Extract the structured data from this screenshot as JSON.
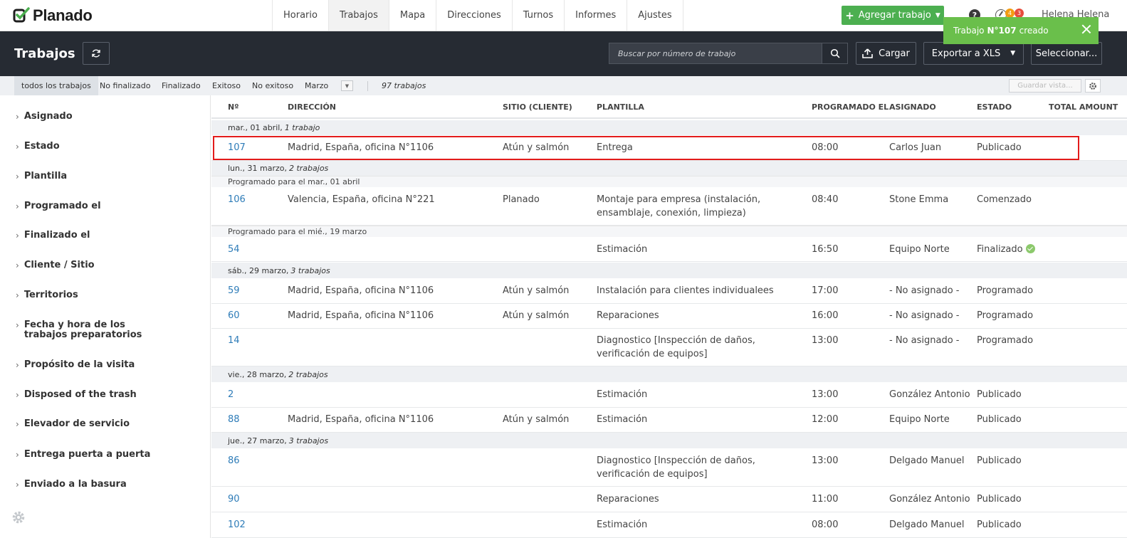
{
  "app": {
    "brand": "Planado"
  },
  "nav": {
    "tabs": [
      {
        "label": "Horario",
        "active": false
      },
      {
        "label": "Trabajos",
        "active": true
      },
      {
        "label": "Mapa",
        "active": false
      },
      {
        "label": "Direcciones",
        "active": false
      },
      {
        "label": "Turnos",
        "active": false
      },
      {
        "label": "Informes",
        "active": false
      },
      {
        "label": "Ajustes",
        "active": false
      }
    ],
    "add_job_label": "Agregar trabajo",
    "help_label": "?",
    "badge_orange": "4",
    "badge_red": "3",
    "user_name": "Helena Helena"
  },
  "toast": {
    "prefix": "Trabajo",
    "number": "N°107",
    "suffix": "creado"
  },
  "header": {
    "title": "Trabajos",
    "search_placeholder": "Buscar por número de trabajo",
    "upload_label": "Cargar",
    "export_label": "Exportar a XLS",
    "select_label": "Seleccionar..."
  },
  "filters": {
    "items": [
      "todos los trabajos",
      "No finalizado",
      "Finalizado",
      "Exitoso",
      "No exitoso",
      "Marzo"
    ],
    "active_index": 0,
    "count": "97 trabajos",
    "save_view": "Guardar vista..."
  },
  "sidebar": {
    "items": [
      "Asignado",
      "Estado",
      "Plantilla",
      "Programado el",
      "Finalizado el",
      "Cliente / Sitio",
      "Territorios",
      "Fecha y hora de los trabajos preparatorios",
      "Propósito de la visita",
      "Disposed of the trash",
      "Elevador de servicio",
      "Entrega puerta a puerta",
      "Enviado a la basura"
    ]
  },
  "table": {
    "columns": [
      "Nº",
      "Dirección",
      "Sitio (cliente)",
      "Plantilla",
      "Programado el",
      "Asignado",
      "Estado",
      "Total amount"
    ],
    "groups": [
      {
        "date": "mar., 01 abril,",
        "count": "1 trabajo"
      },
      {
        "date": "lun., 31 marzo,",
        "count": "2 trabajos"
      },
      {
        "date": "sáb., 29 marzo,",
        "count": "3 trabajos"
      },
      {
        "date": "vie., 28 marzo,",
        "count": "2 trabajos"
      },
      {
        "date": "jue., 27 marzo,",
        "count": "3 trabajos"
      }
    ],
    "subgroups": [
      "Programado para el mar., 01 abril",
      "Programado para el mié., 19 marzo"
    ],
    "rows": [
      {
        "num": "107",
        "address": "Madrid, España, oficina N°1106",
        "site": "Atún y salmón",
        "template": "Entrega",
        "time": "08:00",
        "assignee": "Carlos Juan",
        "status": "Publicado"
      },
      {
        "num": "106",
        "address": "Valencia, España, oficina N°221",
        "site": "Planado",
        "template": "Montaje para empresa (instalación, ensamblaje, conexión, limpieza)",
        "time": "08:40",
        "assignee": "Stone Emma",
        "status": "Comenzado"
      },
      {
        "num": "54",
        "address": "",
        "site": "",
        "template": "Estimación",
        "time": "16:50",
        "assignee": "Equipo Norte",
        "status": "Finalizado"
      },
      {
        "num": "59",
        "address": "Madrid, España, oficina N°1106",
        "site": "Atún y salmón",
        "template": "Instalación para clientes individualees",
        "time": "17:00",
        "assignee": "- No asignado -",
        "status": "Programado"
      },
      {
        "num": "60",
        "address": "Madrid, España, oficina N°1106",
        "site": "Atún y salmón",
        "template": "Reparaciones",
        "time": "16:00",
        "assignee": "- No asignado -",
        "status": "Programado"
      },
      {
        "num": "14",
        "address": "",
        "site": "",
        "template": "Diagnostico [Inspección de daños, verificación de equipos]",
        "time": "13:00",
        "assignee": "- No asignado -",
        "status": "Programado"
      },
      {
        "num": "2",
        "address": "",
        "site": "",
        "template": "Estimación",
        "time": "13:00",
        "assignee": "González Antonio",
        "status": "Publicado"
      },
      {
        "num": "88",
        "address": "Madrid, España, oficina N°1106",
        "site": "Atún y salmón",
        "template": "Estimación",
        "time": "12:00",
        "assignee": "Equipo Norte",
        "status": "Publicado"
      },
      {
        "num": "86",
        "address": "",
        "site": "",
        "template": "Diagnostico [Inspección de daños, verificación de equipos]",
        "time": "13:00",
        "assignee": "Delgado Manuel",
        "status": "Publicado"
      },
      {
        "num": "90",
        "address": "",
        "site": "",
        "template": "Reparaciones",
        "time": "11:00",
        "assignee": "González Antonio",
        "status": "Publicado"
      },
      {
        "num": "102",
        "address": "",
        "site": "",
        "template": "Estimación",
        "time": "08:00",
        "assignee": "Delgado Manuel",
        "status": "Publicado"
      }
    ]
  },
  "colors": {
    "accent_green": "#4caf50",
    "toast_green": "#6abf4b",
    "dark_header": "#262b33",
    "link_blue": "#2e7cb8",
    "highlight_red": "#e31b1b"
  }
}
